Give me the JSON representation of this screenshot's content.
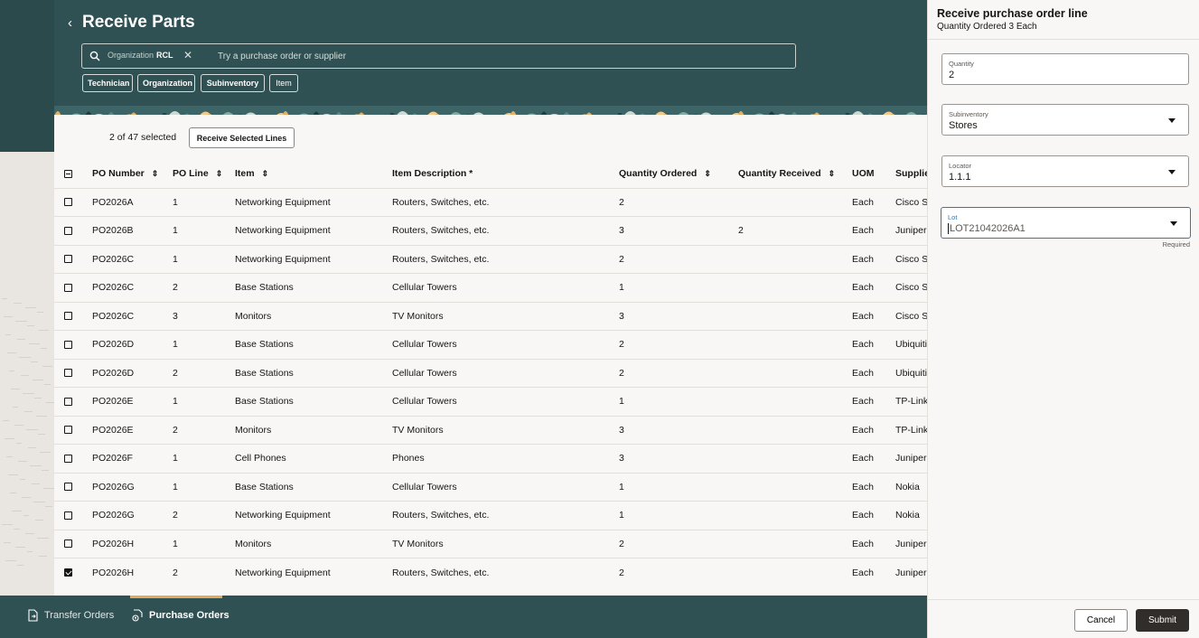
{
  "header": {
    "title": "Receive Parts",
    "search": {
      "chip_label": "Organization",
      "chip_value": "RCL",
      "placeholder": "Try a purchase order or supplier"
    },
    "filters": [
      "Technician",
      "Organization",
      "Subinventory",
      "Item"
    ]
  },
  "selection": {
    "count_text": "2 of 47 selected",
    "receive_button": "Receive Selected Lines"
  },
  "table": {
    "columns": [
      "PO Number",
      "PO Line",
      "Item",
      "Item Description *",
      "Quantity Ordered",
      "Quantity Received",
      "UOM",
      "Supplier"
    ],
    "rows": [
      {
        "po": "PO2026A",
        "line": "1",
        "item": "Networking Equipment",
        "desc": "Routers, Switches, etc.",
        "qo": "2",
        "qr": "",
        "uom": "Each",
        "supplier": "Cisco Systems",
        "checked": false
      },
      {
        "po": "PO2026B",
        "line": "1",
        "item": "Networking Equipment",
        "desc": "Routers, Switches, etc.",
        "qo": "3",
        "qr": "2",
        "uom": "Each",
        "supplier": "Juniper",
        "checked": false
      },
      {
        "po": "PO2026C",
        "line": "1",
        "item": "Networking Equipment",
        "desc": "Routers, Switches, etc.",
        "qo": "2",
        "qr": "",
        "uom": "Each",
        "supplier": "Cisco Systems",
        "checked": false
      },
      {
        "po": "PO2026C",
        "line": "2",
        "item": "Base Stations",
        "desc": "Cellular Towers",
        "qo": "1",
        "qr": "",
        "uom": "Each",
        "supplier": "Cisco Systems",
        "checked": false
      },
      {
        "po": "PO2026C",
        "line": "3",
        "item": "Monitors",
        "desc": "TV Monitors",
        "qo": "3",
        "qr": "",
        "uom": "Each",
        "supplier": "Cisco Systems",
        "checked": false
      },
      {
        "po": "PO2026D",
        "line": "1",
        "item": "Base Stations",
        "desc": "Cellular Towers",
        "qo": "2",
        "qr": "",
        "uom": "Each",
        "supplier": "Ubiquiti",
        "checked": false
      },
      {
        "po": "PO2026D",
        "line": "2",
        "item": "Base Stations",
        "desc": "Cellular Towers",
        "qo": "2",
        "qr": "",
        "uom": "Each",
        "supplier": "Ubiquiti",
        "checked": false
      },
      {
        "po": "PO2026E",
        "line": "1",
        "item": "Base Stations",
        "desc": "Cellular Towers",
        "qo": "1",
        "qr": "",
        "uom": "Each",
        "supplier": "TP-Link",
        "checked": false
      },
      {
        "po": "PO2026E",
        "line": "2",
        "item": "Monitors",
        "desc": "TV Monitors",
        "qo": "3",
        "qr": "",
        "uom": "Each",
        "supplier": "TP-Link",
        "checked": false
      },
      {
        "po": "PO2026F",
        "line": "1",
        "item": "Cell Phones",
        "desc": "Phones",
        "qo": "3",
        "qr": "",
        "uom": "Each",
        "supplier": "Juniper",
        "checked": false
      },
      {
        "po": "PO2026G",
        "line": "1",
        "item": "Base Stations",
        "desc": "Cellular Towers",
        "qo": "1",
        "qr": "",
        "uom": "Each",
        "supplier": "Nokia",
        "checked": false
      },
      {
        "po": "PO2026G",
        "line": "2",
        "item": "Networking Equipment",
        "desc": "Routers, Switches, etc.",
        "qo": "1",
        "qr": "",
        "uom": "Each",
        "supplier": "Nokia",
        "checked": false
      },
      {
        "po": "PO2026H",
        "line": "1",
        "item": "Monitors",
        "desc": "TV Monitors",
        "qo": "2",
        "qr": "",
        "uom": "Each",
        "supplier": "Juniper",
        "checked": false
      },
      {
        "po": "PO2026H",
        "line": "2",
        "item": "Networking Equipment",
        "desc": "Routers, Switches, etc.",
        "qo": "2",
        "qr": "",
        "uom": "Each",
        "supplier": "Juniper",
        "checked": true
      }
    ]
  },
  "bottom_nav": {
    "items": [
      {
        "label": "Transfer Orders",
        "icon": "document-transfer-icon"
      },
      {
        "label": "Purchase Orders",
        "icon": "purchase-order-icon",
        "active": true
      }
    ]
  },
  "drawer": {
    "title": "Receive purchase order line",
    "subtitle": "Quantity Ordered 3 Each",
    "fields": {
      "quantity": {
        "label": "Quantity",
        "value": "2"
      },
      "subinventory": {
        "label": "Subinventory",
        "value": "Stores"
      },
      "locator": {
        "label": "Locator",
        "value": "1.1.1"
      },
      "lot": {
        "label": "Lot",
        "value": "LOT21042026A1",
        "help": "Required"
      }
    },
    "cancel": "Cancel",
    "submit": "Submit"
  },
  "colors": {
    "header_bg": "#2f5154",
    "accent": "#e2aa5a",
    "primary_button": "#312d2a",
    "focus": "#3b76a8"
  }
}
